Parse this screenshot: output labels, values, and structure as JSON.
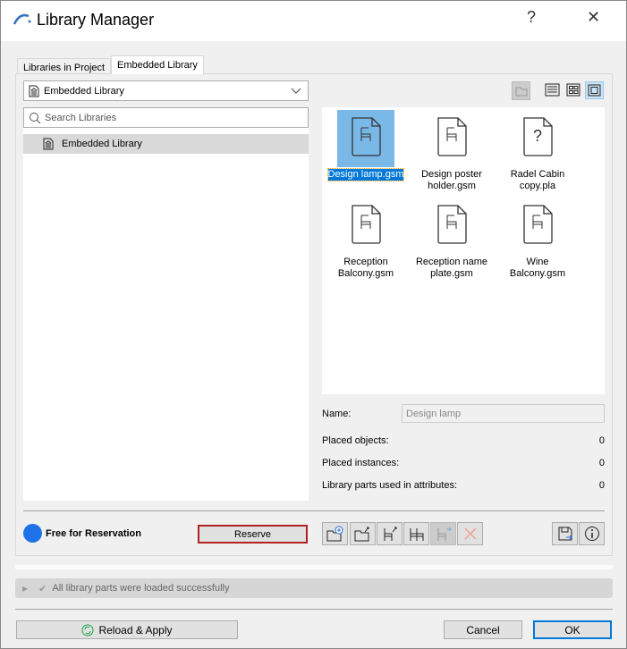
{
  "window": {
    "title": "Library Manager",
    "help": "?",
    "close": "✕"
  },
  "tabs": [
    {
      "label": "Libraries in Project"
    },
    {
      "label": "Embedded Library"
    }
  ],
  "dropdown": {
    "value": "Embedded Library"
  },
  "search": {
    "placeholder": "Search Libraries"
  },
  "tree": [
    {
      "label": "Embedded Library"
    }
  ],
  "items": [
    {
      "label": "Design lamp.gsm",
      "icon": "chair",
      "selected": true
    },
    {
      "label": "Design poster holder.gsm",
      "icon": "chair"
    },
    {
      "label": "Radel Cabin copy.pla",
      "icon": "question"
    },
    {
      "label": "Reception Balcony.gsm",
      "icon": "chair"
    },
    {
      "label": "Reception name plate.gsm",
      "icon": "chair"
    },
    {
      "label": "Wine Balcony.gsm",
      "icon": "chair"
    }
  ],
  "details": {
    "name_label": "Name:",
    "name_value": "Design lamp",
    "placed_objects_label": "Placed objects:",
    "placed_objects": "0",
    "placed_instances_label": "Placed instances:",
    "placed_instances": "0",
    "attr_label": "Library parts used in attributes:",
    "attr_value": "0"
  },
  "reservation": {
    "status": "Free for Reservation",
    "button": "Reserve",
    "status_color": "#1e73e8"
  },
  "status": {
    "message": "All library parts were loaded successfully"
  },
  "footer": {
    "reload": "Reload & Apply",
    "cancel": "Cancel",
    "ok": "OK"
  }
}
